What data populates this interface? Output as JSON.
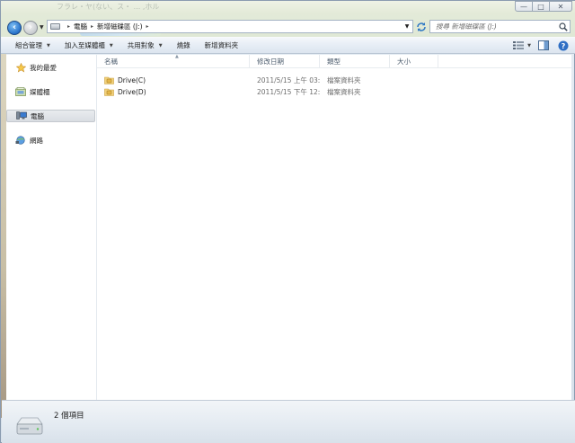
{
  "window": {
    "ghost_title": "フラレ・ヤ(ない、ス・ ... ,ホル",
    "buttons": {
      "minimize": "—",
      "maximize": "□",
      "close": "✕"
    }
  },
  "navigation": {
    "back_icon": "back-arrow-icon",
    "forward_icon": "forward-arrow-icon",
    "breadcrumbs": [
      "電腦",
      "新增磁碟區 (J:)"
    ],
    "search_placeholder": "搜尋 新增磁碟區 (J:)"
  },
  "command_bar": {
    "items": [
      {
        "label": "組合管理",
        "has_dropdown": true
      },
      {
        "label": "加入至媒體櫃",
        "has_dropdown": true
      },
      {
        "label": "共用對象",
        "has_dropdown": true
      },
      {
        "label": "燒錄",
        "has_dropdown": false
      },
      {
        "label": "新增資料夾",
        "has_dropdown": false
      }
    ]
  },
  "sidebar": {
    "items": [
      {
        "label": "我的最愛",
        "icon": "star-icon",
        "selected": false
      },
      {
        "label": "媒體櫃",
        "icon": "library-icon",
        "selected": false
      },
      {
        "label": "電腦",
        "icon": "computer-icon",
        "selected": true
      },
      {
        "label": "網路",
        "icon": "network-icon",
        "selected": false
      }
    ]
  },
  "file_list": {
    "columns": [
      "名稱",
      "修改日期",
      "類型",
      "大小"
    ],
    "rows": [
      {
        "name": "Drive(C)",
        "date": "2011/5/15 上午 03:...",
        "type": "檔案資料夾",
        "size": ""
      },
      {
        "name": "Drive(D)",
        "date": "2011/5/15 下午 12:...",
        "type": "檔案資料夾",
        "size": ""
      }
    ]
  },
  "details": {
    "item_count": "2 個項目",
    "icon": "drive-icon"
  },
  "colors": {
    "accent": "#2771c9",
    "selection_bg": "#dfe3e8",
    "header_text": "#4b5b6c"
  }
}
